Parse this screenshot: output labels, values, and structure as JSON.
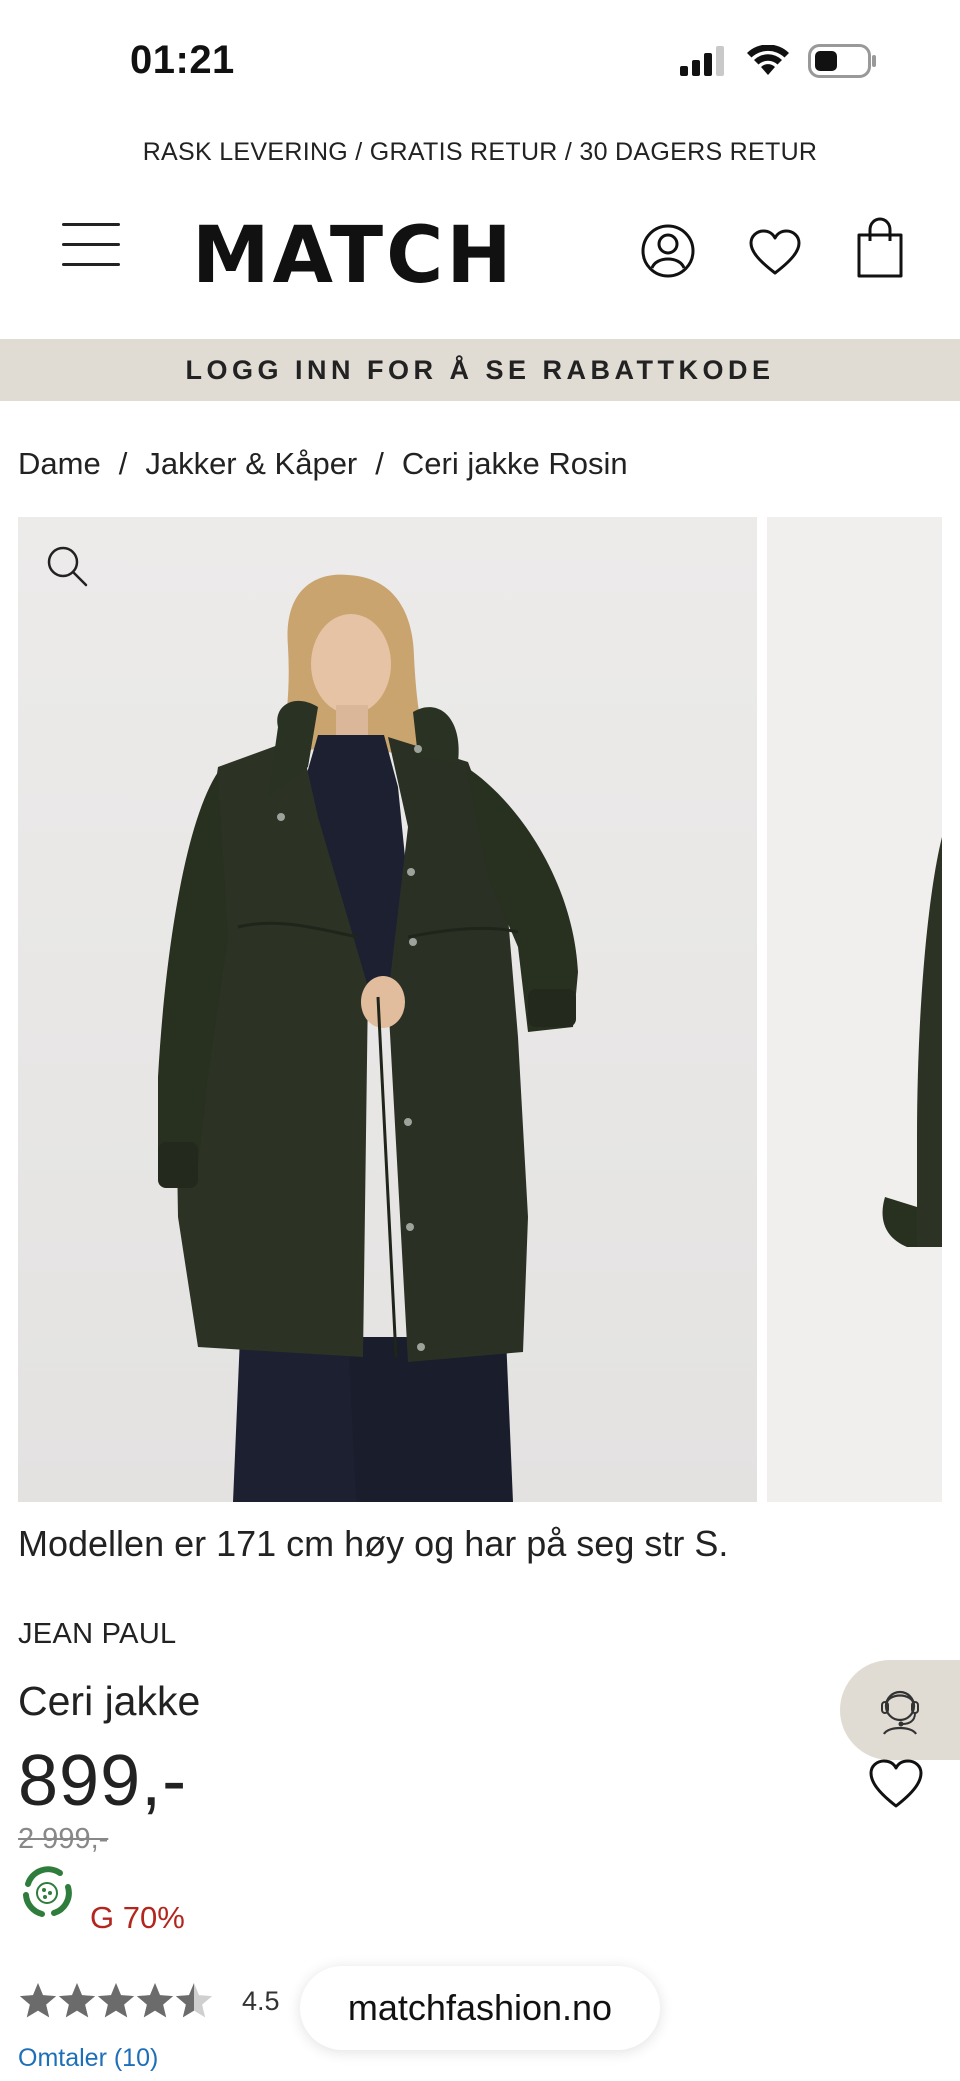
{
  "status_bar": {
    "time": "01:21"
  },
  "promo": {
    "text": "RASK LEVERING / GRATIS RETUR / 30 DAGERS RETUR"
  },
  "header": {
    "logo": "MATCH"
  },
  "login_banner": {
    "text": "LOGG INN FOR Å SE RABATTKODE"
  },
  "breadcrumb": [
    {
      "label": "Dame"
    },
    {
      "label": "Jakker & Kåper"
    },
    {
      "label": "Ceri jakke Rosin"
    }
  ],
  "breadcrumb_separator": "/",
  "product": {
    "model_info": "Modellen er 171 cm høy og har på seg str S.",
    "brand": "JEAN PAUL",
    "name": "Ceri jakke",
    "price": "899,-",
    "old_price": "2 999,-",
    "discount": "G 70%",
    "rating": "4.5",
    "rating_stars": 4.5,
    "reviews_link": "Omtaler (10)"
  },
  "browser": {
    "url": "matchfashion.no"
  },
  "colors": {
    "banner_bg": "#e0dbd3",
    "discount_red": "#b3261e",
    "link_blue": "#1d6fb8",
    "jacket_green": "#2c3325"
  }
}
